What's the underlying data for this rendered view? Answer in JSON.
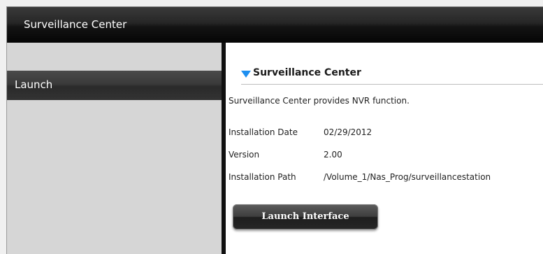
{
  "window": {
    "title": "Surveillance Center"
  },
  "sidebar": {
    "items": [
      {
        "label": "Launch",
        "selected": true
      }
    ]
  },
  "main": {
    "section_title": "Surveillance Center",
    "description": "Surveillance Center provides NVR function.",
    "details": [
      {
        "label": "Installation Date",
        "value": "02/29/2012"
      },
      {
        "label": "Version",
        "value": "2.00"
      },
      {
        "label": "Installation Path",
        "value": "/Volume_1/Nas_Prog/surveillancestation"
      }
    ],
    "launch_button_label": "Launch Interface"
  },
  "colors": {
    "accent": "#1e8ff0",
    "sidebar_bg": "#d6d6d6",
    "titlebar_bg": "#1a1a1a"
  }
}
